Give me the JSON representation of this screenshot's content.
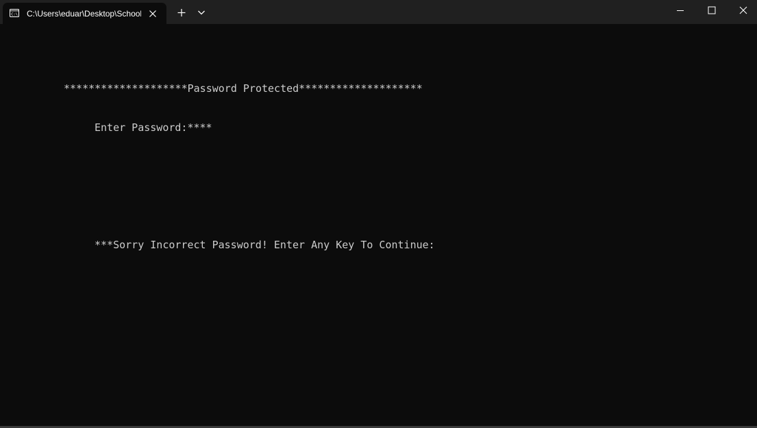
{
  "tab": {
    "title": "C:\\Users\\eduar\\Desktop\\School",
    "icon": "terminal-icon",
    "close_icon": "close-icon"
  },
  "titlebar": {
    "new_tab_icon": "plus-icon",
    "dropdown_icon": "chevron-down-icon",
    "minimize_icon": "minimize-icon",
    "maximize_icon": "maximize-icon",
    "close_icon": "close-icon"
  },
  "console": {
    "header_line": "********************Password Protected********************",
    "password_prompt": "Enter Password:****",
    "error_line": "***Sorry Incorrect Password! Enter Any Key To Continue:"
  },
  "colors": {
    "titlebar_bg": "#202020",
    "console_bg": "#0c0c0c",
    "console_text": "#cccccc",
    "tab_text": "#ffffff"
  }
}
